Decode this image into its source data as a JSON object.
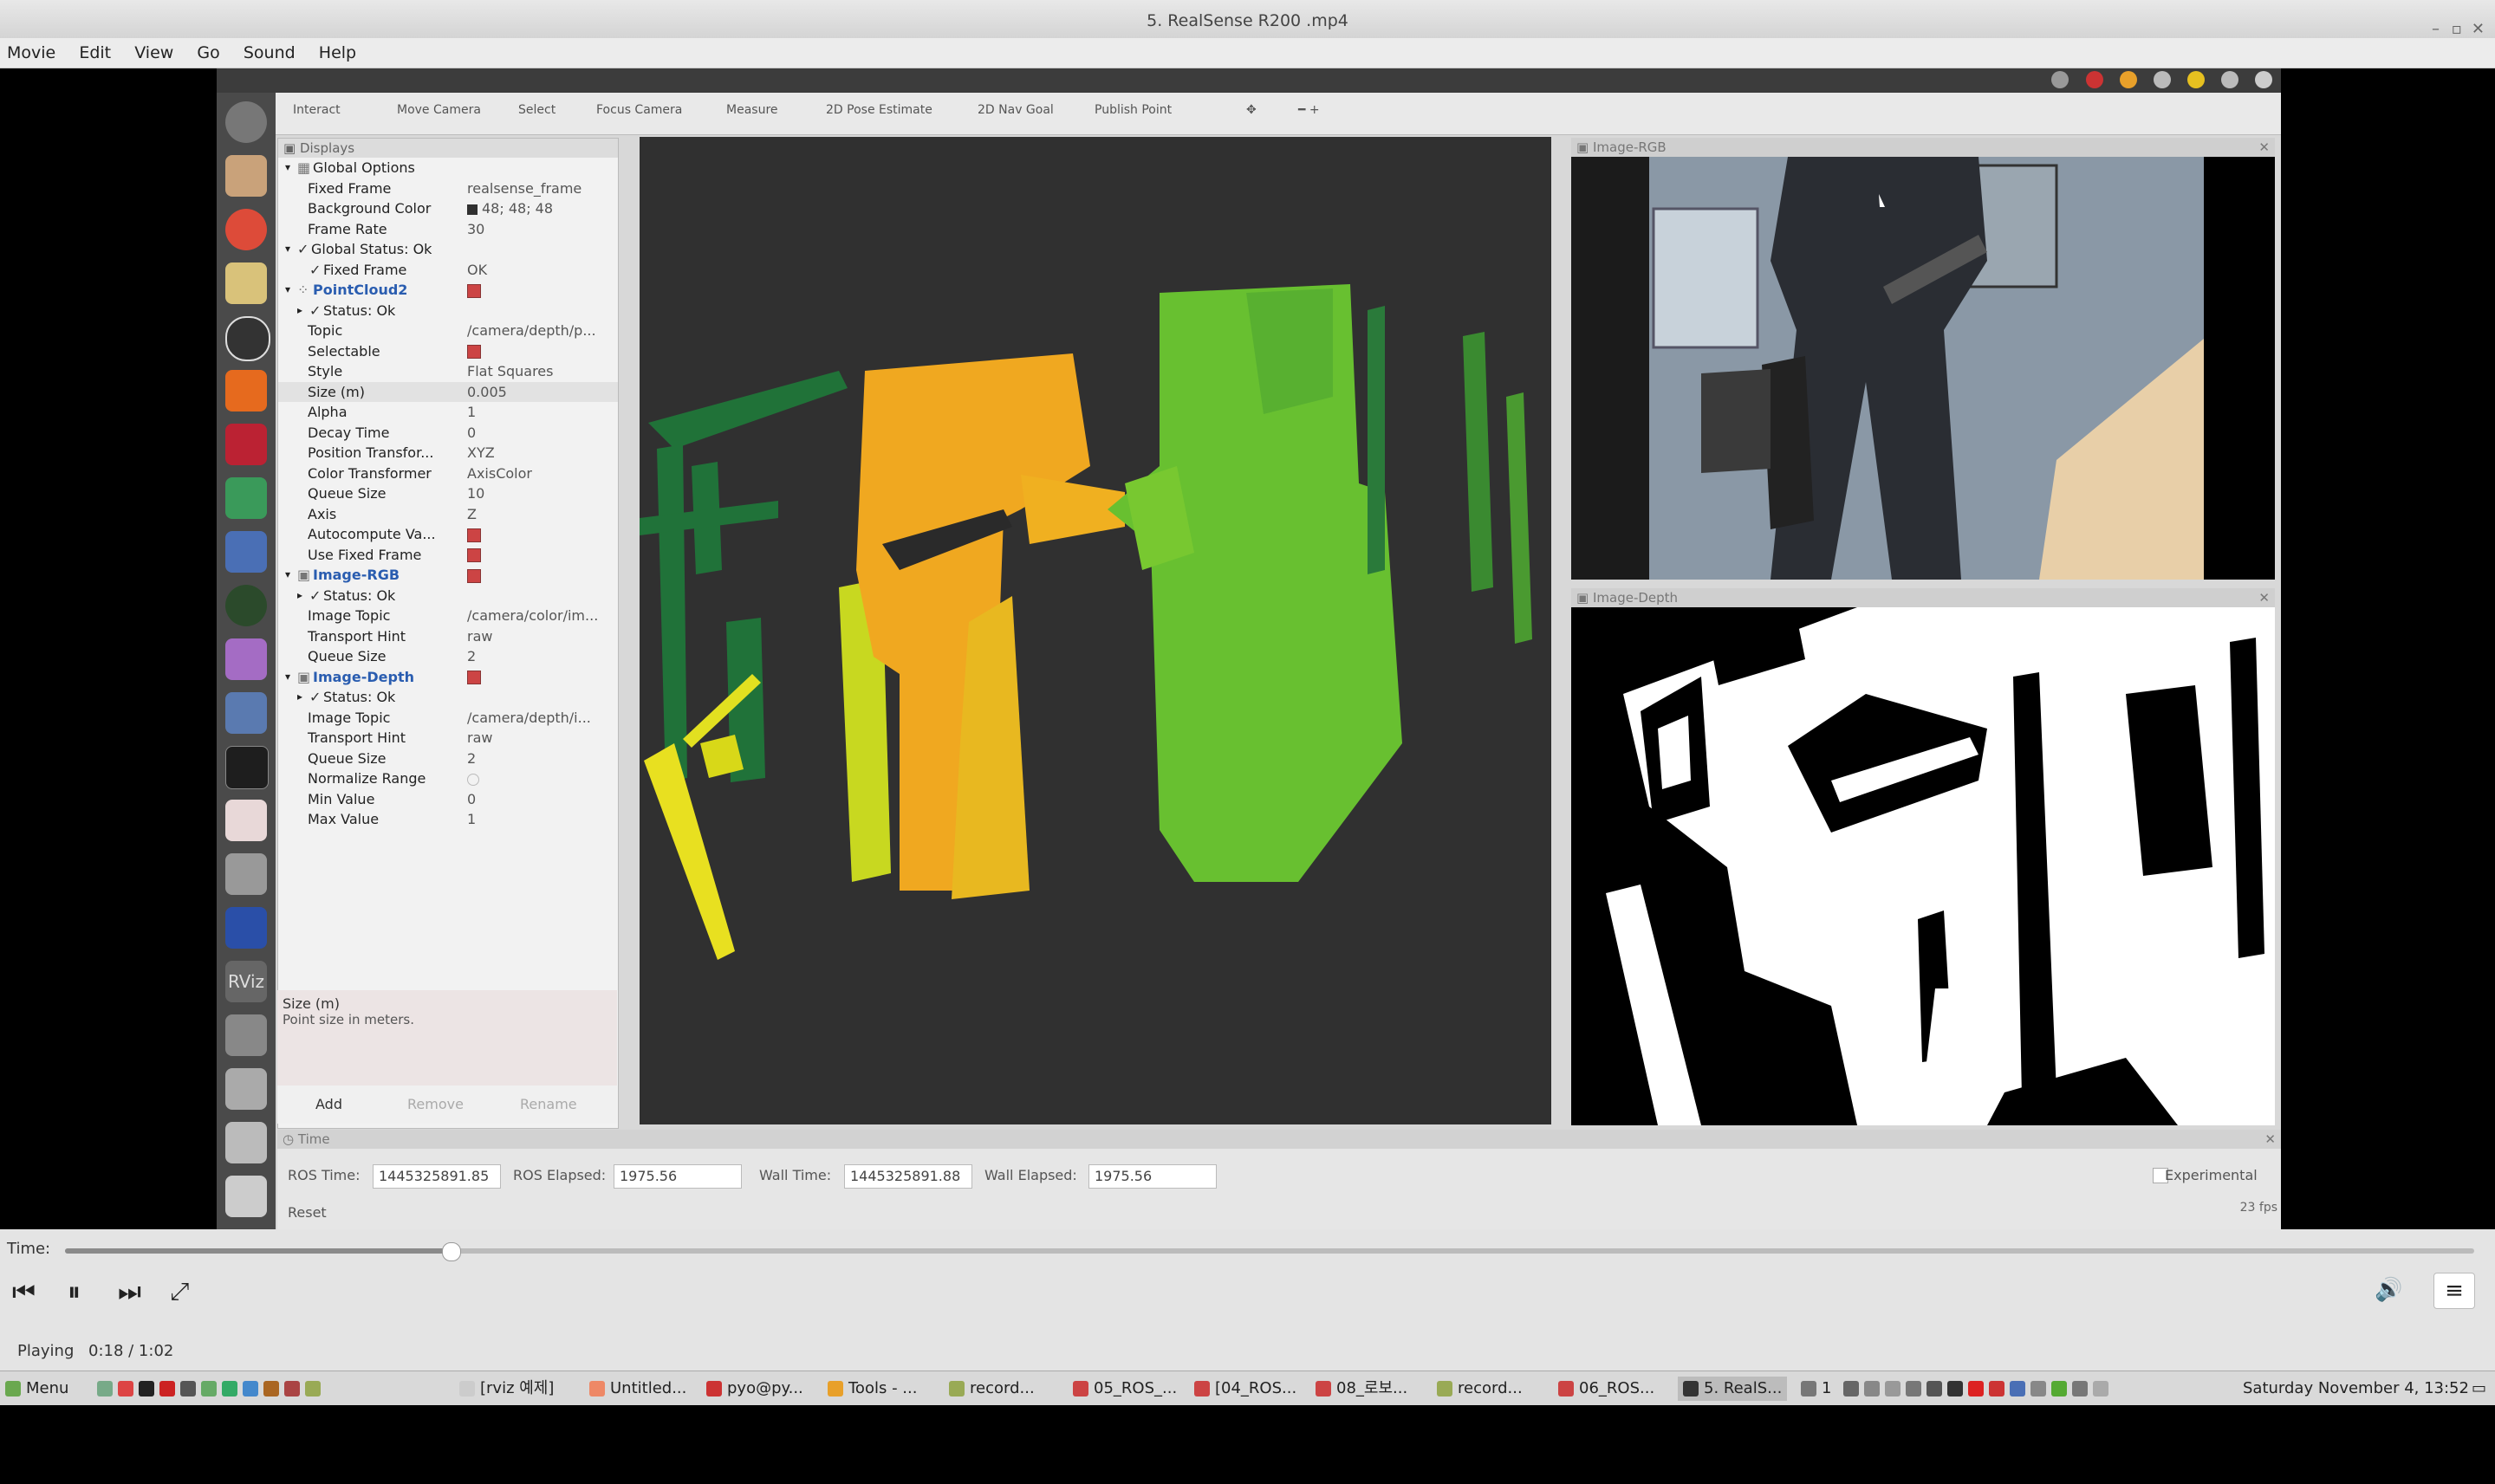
{
  "window": {
    "title": "5. RealSense R200 .mp4"
  },
  "menu": [
    "Movie",
    "Edit",
    "View",
    "Go",
    "Sound",
    "Help"
  ],
  "rviz_toolbar": [
    "Interact",
    "Move Camera",
    "Select",
    "Focus Camera",
    "Measure",
    "2D Pose Estimate",
    "2D Nav Goal",
    "Publish Point"
  ],
  "displays": {
    "header": "Displays",
    "rows": [
      {
        "k": "Global Options",
        "v": "",
        "indent": 0,
        "arrow": "▾",
        "icon": "grid"
      },
      {
        "k": "Fixed Frame",
        "v": "realsense_frame",
        "indent": 1
      },
      {
        "k": "Background Color",
        "v": "48; 48; 48",
        "indent": 1,
        "swatch": "#303030"
      },
      {
        "k": "Frame Rate",
        "v": "30",
        "indent": 1
      },
      {
        "k": "Global Status: Ok",
        "v": "",
        "indent": 0,
        "arrow": "▾",
        "check": true
      },
      {
        "k": "Fixed Frame",
        "v": "OK",
        "indent": 1,
        "check": true
      },
      {
        "k": "PointCloud2",
        "v": "",
        "indent": 0,
        "arrow": "▾",
        "icon": "cloud",
        "blue": true,
        "box": true
      },
      {
        "k": "Status: Ok",
        "v": "",
        "indent": 1,
        "arrow": "▸",
        "check": true
      },
      {
        "k": "Topic",
        "v": "/camera/depth/p...",
        "indent": 1
      },
      {
        "k": "Selectable",
        "v": "",
        "indent": 1,
        "box": true
      },
      {
        "k": "Style",
        "v": "Flat Squares",
        "indent": 1
      },
      {
        "k": "Size (m)",
        "v": "0.005",
        "indent": 1,
        "hl": true
      },
      {
        "k": "Alpha",
        "v": "1",
        "indent": 1
      },
      {
        "k": "Decay Time",
        "v": "0",
        "indent": 1
      },
      {
        "k": "Position Transfor...",
        "v": "XYZ",
        "indent": 1
      },
      {
        "k": "Color Transformer",
        "v": "AxisColor",
        "indent": 1
      },
      {
        "k": "Queue Size",
        "v": "10",
        "indent": 1
      },
      {
        "k": "Axis",
        "v": "Z",
        "indent": 1
      },
      {
        "k": "Autocompute Va...",
        "v": "",
        "indent": 1,
        "box": true
      },
      {
        "k": "Use Fixed Frame",
        "v": "",
        "indent": 1,
        "box": true
      },
      {
        "k": "Image-RGB",
        "v": "",
        "indent": 0,
        "arrow": "▾",
        "icon": "img",
        "blue": true,
        "box": true
      },
      {
        "k": "Status: Ok",
        "v": "",
        "indent": 1,
        "arrow": "▸",
        "check": true
      },
      {
        "k": "Image Topic",
        "v": "/camera/color/im...",
        "indent": 1
      },
      {
        "k": "Transport Hint",
        "v": "raw",
        "indent": 1
      },
      {
        "k": "Queue Size",
        "v": "2",
        "indent": 1
      },
      {
        "k": "Image-Depth",
        "v": "",
        "indent": 0,
        "arrow": "▾",
        "icon": "img",
        "blue": true,
        "box": true
      },
      {
        "k": "Status: Ok",
        "v": "",
        "indent": 1,
        "arrow": "▸",
        "check": true
      },
      {
        "k": "Image Topic",
        "v": "/camera/depth/i...",
        "indent": 1
      },
      {
        "k": "Transport Hint",
        "v": "raw",
        "indent": 1
      },
      {
        "k": "Queue Size",
        "v": "2",
        "indent": 1
      },
      {
        "k": "Normalize Range",
        "v": "",
        "indent": 1,
        "emptybox": true
      },
      {
        "k": "Min Value",
        "v": "0",
        "indent": 1
      },
      {
        "k": "Max Value",
        "v": "1",
        "indent": 1
      }
    ],
    "help_title": "Size (m)",
    "help_text": "Point size in meters.",
    "buttons": [
      "Add",
      "Remove",
      "Rename"
    ]
  },
  "panels": {
    "rgb_title": "Image-RGB",
    "depth_title": "Image-Depth"
  },
  "time": {
    "header": "Time",
    "ros_time_label": "ROS Time:",
    "ros_time": "1445325891.85",
    "ros_elapsed_label": "ROS Elapsed:",
    "ros_elapsed": "1975.56",
    "wall_time_label": "Wall Time:",
    "wall_time": "1445325891.88",
    "wall_elapsed_label": "Wall Elapsed:",
    "wall_elapsed": "1975.56",
    "experimental": "Experimental",
    "reset": "Reset",
    "fps": "23 fps"
  },
  "player": {
    "time_label": "Time:",
    "progress_fraction": 0.16,
    "status": "Playing",
    "position": "0:18 / 1:02"
  },
  "taskbar": {
    "menu": "Menu",
    "tasks": [
      "[rviz 예제]",
      "Untitled...",
      "pyo@py...",
      "Tools - ...",
      "record...",
      "05_ROS_...",
      "[04_ROS...",
      "08_로보...",
      "record...",
      "06_ROS...",
      "5. RealS..."
    ],
    "clock": "Saturday November 4, 13:52",
    "workspace": "1"
  },
  "colors": {
    "accent_blue": "#2a5db0",
    "bg_3d": "#303030"
  }
}
